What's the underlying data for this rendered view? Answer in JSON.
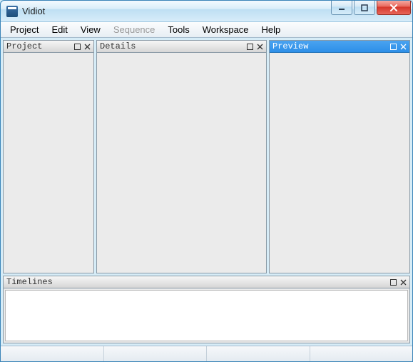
{
  "window": {
    "title": "Vidiot"
  },
  "menu": {
    "items": [
      {
        "label": "Project",
        "enabled": true
      },
      {
        "label": "Edit",
        "enabled": true
      },
      {
        "label": "View",
        "enabled": true
      },
      {
        "label": "Sequence",
        "enabled": false
      },
      {
        "label": "Tools",
        "enabled": true
      },
      {
        "label": "Workspace",
        "enabled": true
      },
      {
        "label": "Help",
        "enabled": true
      }
    ]
  },
  "panels": {
    "project": {
      "title": "Project",
      "active": false
    },
    "details": {
      "title": "Details",
      "active": false
    },
    "preview": {
      "title": "Preview",
      "active": true
    },
    "timelines": {
      "title": "Timelines",
      "active": false
    }
  }
}
